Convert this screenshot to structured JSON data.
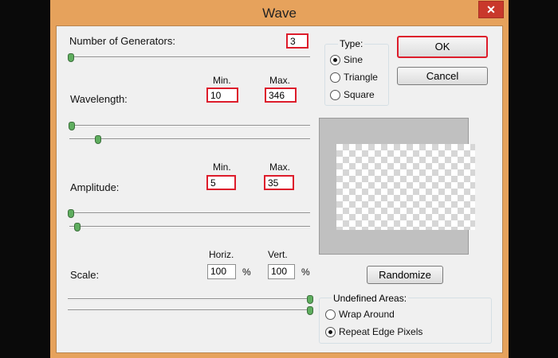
{
  "window": {
    "title": "Wave",
    "close_glyph": "✕"
  },
  "generators": {
    "label": "Number of Generators:",
    "value": "3"
  },
  "wavelength": {
    "label": "Wavelength:",
    "min_label": "Min.",
    "max_label": "Max.",
    "min_value": "10",
    "max_value": "346"
  },
  "amplitude": {
    "label": "Amplitude:",
    "min_label": "Min.",
    "max_label": "Max.",
    "min_value": "5",
    "max_value": "35"
  },
  "scale": {
    "label": "Scale:",
    "horiz_label": "Horiz.",
    "vert_label": "Vert.",
    "horiz_value": "100",
    "vert_value": "100",
    "percent": "%"
  },
  "type": {
    "legend": "Type:",
    "options": [
      "Sine",
      "Triangle",
      "Square"
    ],
    "selected": "Sine"
  },
  "buttons": {
    "ok": "OK",
    "cancel": "Cancel",
    "randomize": "Randomize"
  },
  "undefined_areas": {
    "legend": "Undefined Areas:",
    "options": [
      "Wrap Around",
      "Repeat Edge Pixels"
    ],
    "selected": "Repeat Edge Pixels"
  },
  "colors": {
    "title_bar": "#e6a25c",
    "highlight": "#dd1c2b",
    "close_button": "#c9382b",
    "slider_thumb": "#5fae5f"
  }
}
